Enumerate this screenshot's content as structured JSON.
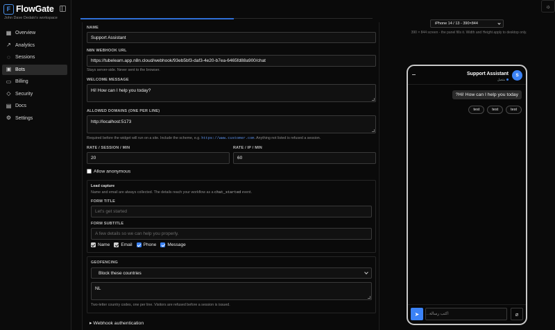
{
  "brand": {
    "logo_letter": "F",
    "name": "FlowGate",
    "workspace": "John Dave Dedalo's workspace"
  },
  "sidebar": {
    "items": [
      {
        "label": "Overview",
        "icon": "grid-icon"
      },
      {
        "label": "Analytics",
        "icon": "trend-icon"
      },
      {
        "label": "Sessions",
        "icon": "chat-icon"
      },
      {
        "label": "Bots",
        "icon": "bot-icon",
        "active": true
      },
      {
        "label": "Billing",
        "icon": "card-icon"
      },
      {
        "label": "Security",
        "icon": "shield-icon"
      },
      {
        "label": "Docs",
        "icon": "book-icon"
      },
      {
        "label": "Settings",
        "icon": "gear-icon"
      }
    ]
  },
  "form": {
    "name_label": "NAME",
    "name_value": "Support Assistant",
    "webhook_label": "N8N WEBHOOK URL",
    "webhook_value": "https://tubelearn.app.n8n.cloud/webhook/93eb5bf3-daf3-4e20-b7ea-6465fd88a900/chat",
    "webhook_help": "Stays server-side. Never sent to the browser.",
    "welcome_label": "WELCOME MESSAGE",
    "welcome_value": "Hi! How can I help you today?",
    "domains_label": "ALLOWED DOMAINS (ONE PER LINE)",
    "domains_value": "http://localhost:5173",
    "domains_help_pre": "Required before the widget will run on a site. Include the scheme, e.g.",
    "domains_help_code": "https://www.customer.com",
    "domains_help_post": ". Anything not listed is refused a session.",
    "rate_session_label": "RATE / SESSION / MIN",
    "rate_session_value": "20",
    "rate_ip_label": "RATE / IP / MIN",
    "rate_ip_value": "60",
    "allow_anonymous_label": "Allow anonymous"
  },
  "lead": {
    "title": "Lead capture",
    "desc_pre": "Name and email are always collected. The details reach your workflow as a",
    "desc_code": "chat_started",
    "desc_post": "event.",
    "form_title_label": "FORM TITLE",
    "form_title_placeholder": "Let's get started",
    "form_subtitle_label": "FORM SUBTITLE",
    "form_subtitle_placeholder": "A few details so we can help you properly.",
    "fields": {
      "name": "Name",
      "email": "Email",
      "phone": "Phone",
      "message": "Message"
    }
  },
  "geo": {
    "label": "GEOFENCING",
    "mode": "Block these countries",
    "countries": "NL",
    "help": "Two-letter country codes, one per line. Visitors are refused before a session is issued."
  },
  "webhook_auth": {
    "label": "Webhook authentication"
  },
  "preview": {
    "device": "iPhone 14 / 13 - 390×844",
    "note": "390 × 844 screen - the panel fills it. Width and Height apply to desktop only.",
    "bot_name": "Support Assistant",
    "bot_status": "متصل",
    "avatar_letter": "S",
    "welcome_bubble": "?Hi! How can I help you today",
    "chips": [
      "test",
      "test",
      "test"
    ],
    "input_placeholder": "اكتب رسالة..."
  },
  "colors": {
    "accent": "#3b82f6",
    "background": "#0a0a0a",
    "border": "#3a3a3a"
  }
}
